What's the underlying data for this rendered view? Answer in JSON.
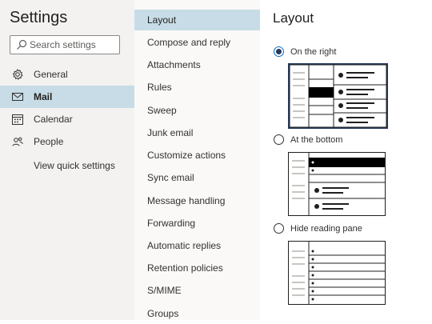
{
  "settings": {
    "title": "Settings",
    "search_placeholder": "Search settings",
    "nav": [
      {
        "label": "General",
        "icon": "gear-icon"
      },
      {
        "label": "Mail",
        "icon": "mail-icon"
      },
      {
        "label": "Calendar",
        "icon": "calendar-icon"
      },
      {
        "label": "People",
        "icon": "people-icon"
      }
    ],
    "quick_settings": "View quick settings"
  },
  "mail_menu": [
    "Layout",
    "Compose and reply",
    "Attachments",
    "Rules",
    "Sweep",
    "Junk email",
    "Customize actions",
    "Sync email",
    "Message handling",
    "Forwarding",
    "Automatic replies",
    "Retention policies",
    "S/MIME",
    "Groups"
  ],
  "layout": {
    "title": "Layout",
    "options": [
      {
        "label": "On the right",
        "selected": true
      },
      {
        "label": "At the bottom",
        "selected": false
      },
      {
        "label": "Hide reading pane",
        "selected": false
      }
    ]
  },
  "colors": {
    "accent": "#0f6cbd",
    "selected_bg": "#c7dce6",
    "sidebar_bg": "#f3f2f1"
  }
}
